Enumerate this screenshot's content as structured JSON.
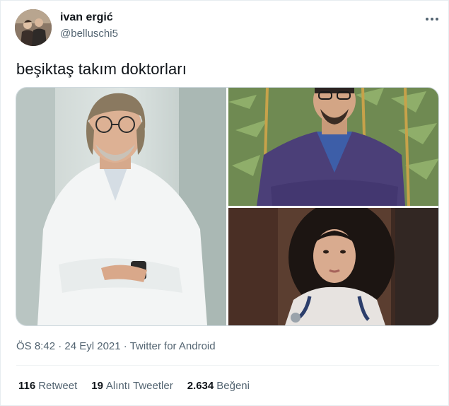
{
  "user": {
    "display_name": "ivan ergić",
    "handle": "@belluschi5",
    "avatar_icon": "user-avatar"
  },
  "tweet": {
    "text": "beşiktaş takım doktorları",
    "time": "ÖS 8:42",
    "date": "24 Eyl 2021",
    "source": "Twitter for Android",
    "separator": "·"
  },
  "media": {
    "count": 3
  },
  "stats": {
    "retweets_count": "116",
    "retweets_label": "Retweet",
    "quotes_count": "19",
    "quotes_label": "Alıntı Tweetler",
    "likes_count": "2.634",
    "likes_label": "Beğeni"
  },
  "colors": {
    "text_primary": "#0f1419",
    "text_secondary": "#536471",
    "border": "#cfd9de"
  }
}
